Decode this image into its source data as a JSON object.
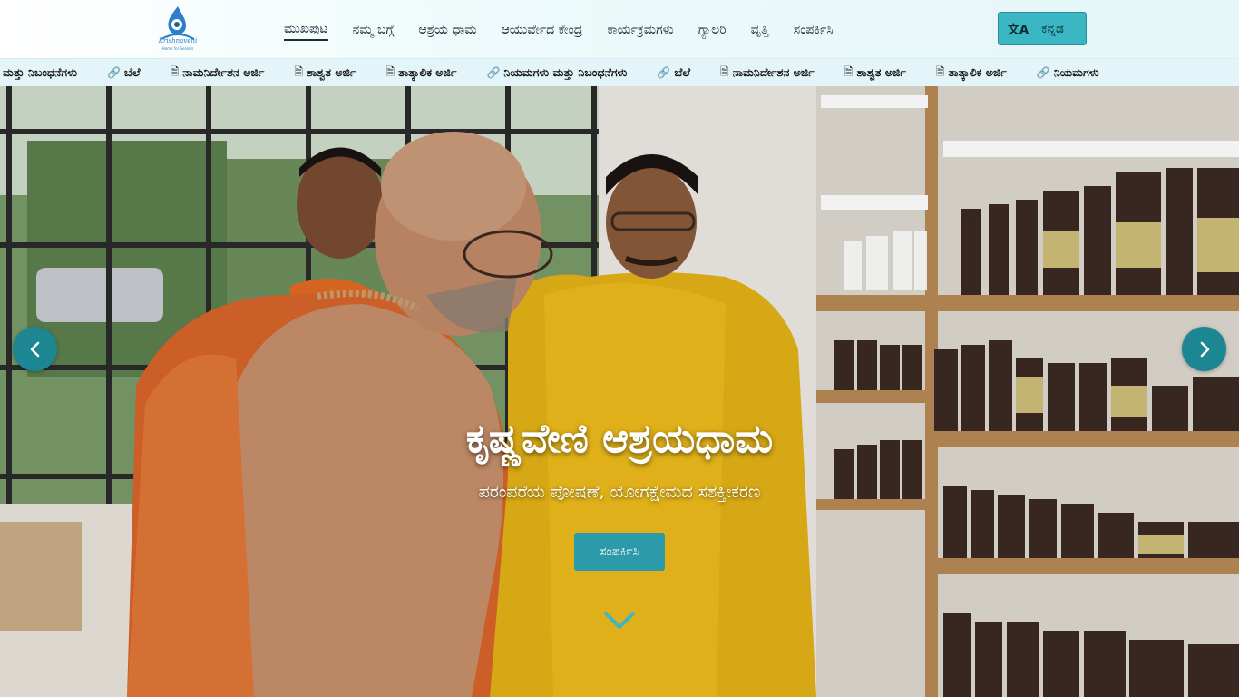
{
  "header": {
    "logo_alt": "Krishnaveni",
    "nav": [
      {
        "label": "ಮುಖಪುಟ",
        "active": true
      },
      {
        "label": "ನಮ್ಮ ಬಗ್ಗೆ"
      },
      {
        "label": "ಆಶ್ರಯ ಧಾಮ"
      },
      {
        "label": "ಆಯುರ್ವೇದ ಕೇಂದ್ರ"
      },
      {
        "label": "ಕಾರ್ಯಕ್ರಮಗಳು"
      },
      {
        "label": "ಗ್ಯಾಲರಿ"
      },
      {
        "label": "ವೃತ್ತಿ"
      },
      {
        "label": "ಸಂಪರ್ಕಿಸಿ"
      }
    ],
    "language_button": {
      "icon": "translate-icon",
      "label": "ಕನ್ನಡ"
    }
  },
  "ticker": {
    "items": [
      {
        "icon": "link-icon",
        "label": "ನಿಯಮಗಳು ಮತ್ತು ನಿಬಂಧನೆಗಳು"
      },
      {
        "icon": "link-icon",
        "label": "ಬೆಲೆ"
      },
      {
        "icon": "document-icon",
        "label": "ನಾಮನಿರ್ದೇಶನ ಅರ್ಜಿ"
      },
      {
        "icon": "document-icon",
        "label": "ಶಾಶ್ವತ ಅರ್ಜಿ"
      },
      {
        "icon": "document-icon",
        "label": "ತಾತ್ಕಾಲಿಕ ಅರ್ಜಿ"
      },
      {
        "icon": "link-icon",
        "label": "ನಿಯಮಗಳು ಮತ್ತು ನಿಬಂಧನೆಗಳು"
      },
      {
        "icon": "link-icon",
        "label": "ಬೆಲೆ"
      },
      {
        "icon": "document-icon",
        "label": "ನಾಮನಿರ್ದೇಶನ ಅರ್ಜಿ"
      },
      {
        "icon": "document-icon",
        "label": "ಶಾಶ್ವತ ಅರ್ಜಿ"
      },
      {
        "icon": "document-icon",
        "label": "ತಾತ್ಕಾಲಿಕ ಅರ್ಜಿ"
      },
      {
        "icon": "link-icon",
        "label": "ನಿಯಮಗಳು"
      }
    ]
  },
  "hero": {
    "title": "ಕೃಷ್ಣವೇಣಿ ಆಶ್ರಯಧಾಮ",
    "subtitle": "ಪರಂಪರೆಯ ಪೋಷಣೆ, ಯೋಗಕ್ಷೇಮದ ಸಶಕ್ತೀಕರಣ",
    "cta_label": "ಸಂಪರ್ಕಿಸಿ",
    "prev_icon": "chevron-left-icon",
    "next_icon": "chevron-right-icon",
    "scroll_icon": "chevron-down-icon"
  },
  "colors": {
    "accent": "#2c9aa8",
    "arrow_bg": "#1c8792",
    "header_bg": "#e4f6f8"
  }
}
